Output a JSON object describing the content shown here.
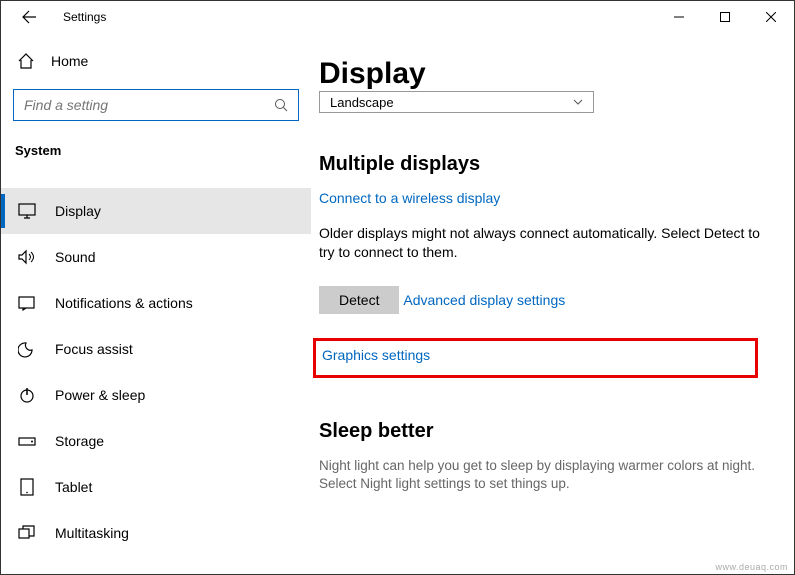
{
  "titlebar": {
    "title": "Settings"
  },
  "sidebar": {
    "home_label": "Home",
    "search_placeholder": "Find a setting",
    "section_label": "System",
    "items": [
      {
        "name": "display",
        "label": "Display"
      },
      {
        "name": "sound",
        "label": "Sound"
      },
      {
        "name": "notifications",
        "label": "Notifications & actions"
      },
      {
        "name": "focus-assist",
        "label": "Focus assist"
      },
      {
        "name": "power-sleep",
        "label": "Power & sleep"
      },
      {
        "name": "storage",
        "label": "Storage"
      },
      {
        "name": "tablet",
        "label": "Tablet"
      },
      {
        "name": "multitasking",
        "label": "Multitasking"
      }
    ]
  },
  "content": {
    "page_title": "Display",
    "orientation_value": "Landscape",
    "multiple_displays": {
      "heading": "Multiple displays",
      "wireless_link": "Connect to a wireless display",
      "help_text": "Older displays might not always connect automatically. Select Detect to try to connect to them.",
      "detect_label": "Detect",
      "advanced_link": "Advanced display settings",
      "graphics_link": "Graphics settings"
    },
    "sleep_better": {
      "heading": "Sleep better",
      "help_text": "Night light can help you get to sleep by displaying warmer colors at night. Select Night light settings to set things up."
    }
  },
  "watermark": "www.deuaq.com"
}
